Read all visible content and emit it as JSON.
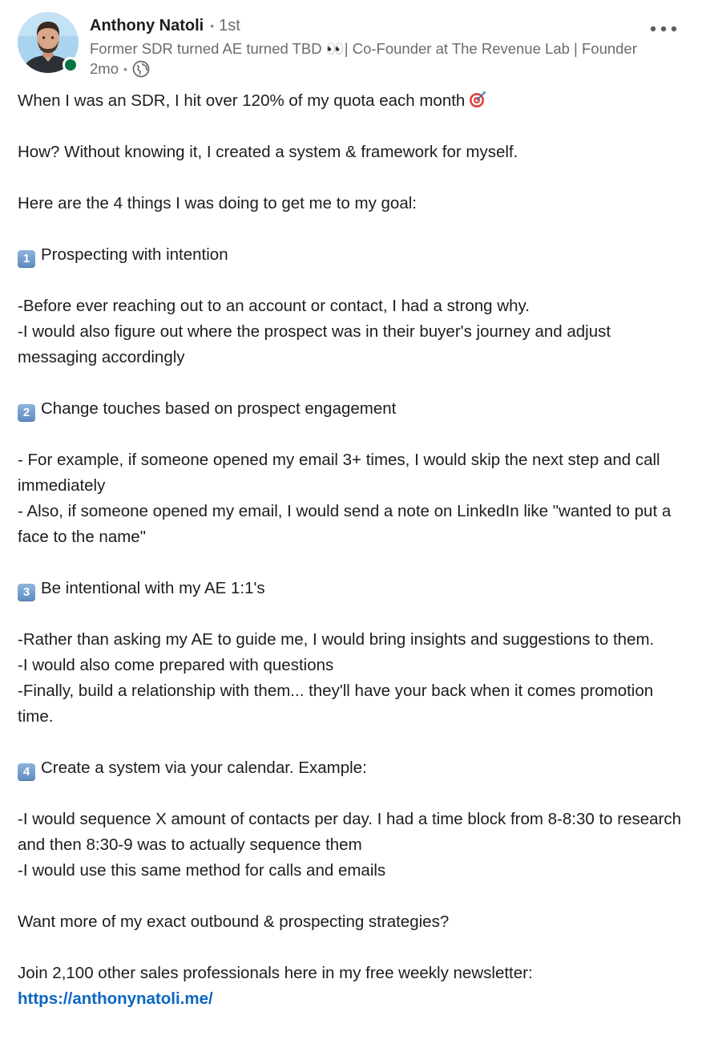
{
  "author": {
    "name": "Anthony Natoli",
    "connection_degree": "1st",
    "headline": "Former SDR turned AE turned TBD 👀| Co-Founder at The Revenue Lab | Founder",
    "post_age": "2mo",
    "separator": "•",
    "presence_color": "#057642",
    "visibility_icon": "globe-icon"
  },
  "post": {
    "more_icon": "ellipsis-icon",
    "intro": "When I was an SDR, I hit over 120% of my quota each month",
    "intro_icon": "target-icon",
    "how": "How? Without knowing it, I created a system & framework for myself.",
    "lead_in": "Here are the 4 things I was doing to get me to my goal:",
    "sections": [
      {
        "number": "1",
        "title": "Prospecting with intention",
        "lines": [
          "-Before ever reaching out to an account or contact, I had a strong why.",
          "-I would also figure out where the prospect was in their buyer's journey and adjust messaging accordingly"
        ]
      },
      {
        "number": "2",
        "title": "Change touches based on prospect engagement",
        "lines": [
          "- For example, if someone opened my email 3+ times, I would skip the next step and call immediately",
          "- Also, if someone opened my email, I would send a note on LinkedIn like \"wanted to put a face to the name\""
        ]
      },
      {
        "number": "3",
        "title": "Be intentional with my AE 1:1's",
        "lines": [
          "-Rather than asking my AE to guide me, I would bring insights and suggestions to them.",
          "-I would also come prepared with questions",
          "-Finally, build a relationship with them... they'll have your back when it comes promotion time."
        ]
      },
      {
        "number": "4",
        "title": "Create a system via your calendar. Example:",
        "lines": [
          "-I would sequence X amount of contacts per day. I had a time block from 8-8:30 to research and then 8:30-9 was to actually sequence them",
          "-I would use this same method for calls and emails"
        ]
      }
    ],
    "cta_question": "Want more of my exact outbound & prospecting strategies?",
    "cta_text": "Join 2,100 other sales professionals here in my free weekly newsletter:",
    "cta_link": "https://anthonynatoli.me/"
  }
}
